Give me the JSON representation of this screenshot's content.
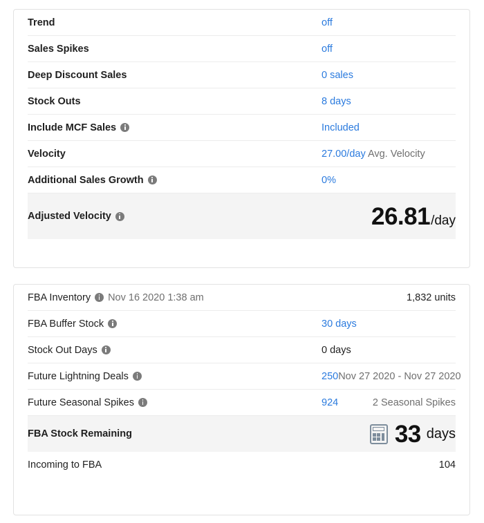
{
  "theme": {
    "link_blue": "#2a7ade",
    "muted_gray": "#6f6f6f",
    "text_dark": "#1f1f1f",
    "highlight_bg": "#f4f4f4",
    "card_border": "#e2e2e2",
    "calc_icon_color": "#7d8d9c"
  },
  "velocity_card": {
    "rows": [
      {
        "label": "Trend",
        "value": "off",
        "value_style": "blue"
      },
      {
        "label": "Sales Spikes",
        "value": "off",
        "value_style": "blue"
      },
      {
        "label": "Deep Discount Sales",
        "value": "0 sales",
        "value_style": "blue"
      },
      {
        "label": "Stock Outs",
        "value": "8 days",
        "value_style": "blue"
      },
      {
        "label": "Include MCF Sales",
        "info": "info-icon",
        "value": "Included",
        "value_style": "blue"
      },
      {
        "label": "Velocity",
        "value": "27.00/day",
        "value_style": "blue",
        "suffix": "Avg. Velocity"
      },
      {
        "label": "Additional Sales Growth",
        "info": "info-icon",
        "value": "0%",
        "value_style": "blue"
      }
    ],
    "summary": {
      "label": "Adjusted Velocity",
      "info": "info-icon",
      "number": "26.81",
      "unit": "/day"
    }
  },
  "stock_card": {
    "inventory": {
      "label": "FBA Inventory",
      "info": "info-icon",
      "timestamp": "Nov 16 2020 1:38 am",
      "value": "1,832 units"
    },
    "rows": [
      {
        "label": "FBA Buffer Stock",
        "info": "info-icon",
        "value": "30 days",
        "value_style": "blue"
      },
      {
        "label": "Stock Out Days",
        "info": "info-icon",
        "value": "0 days",
        "value_style": "dark"
      }
    ],
    "lightning_deals": {
      "label": "Future Lightning Deals",
      "info": "info-icon",
      "value": "250",
      "range": "Nov 27 2020 - Nov 27 2020"
    },
    "seasonal_spikes": {
      "label": "Future Seasonal Spikes",
      "info": "info-icon",
      "value": "924",
      "note": "2 Seasonal Spikes"
    },
    "summary": {
      "label": "FBA Stock Remaining",
      "icon": "calculator-icon",
      "number": "33",
      "unit": "days"
    },
    "incoming": {
      "label": "Incoming to FBA",
      "value": "104"
    }
  }
}
